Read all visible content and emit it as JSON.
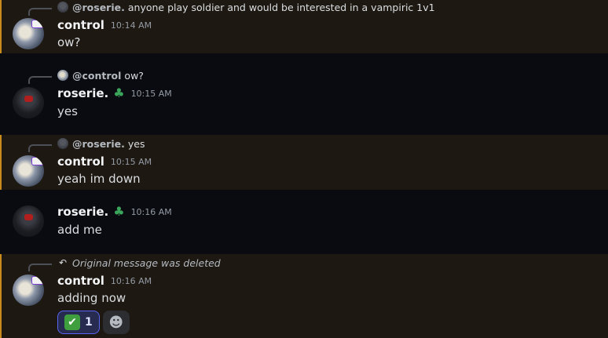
{
  "messages": [
    {
      "author": "control",
      "timestamp": "10:14 AM",
      "content": "ow?",
      "highlighted": true,
      "reply": {
        "user": "@roserie.",
        "text": "anyone play soldier and would be interested in a vampiric 1v1"
      }
    },
    {
      "author": "roserie.",
      "badge_icon": "clover-icon",
      "timestamp": "10:15 AM",
      "content": "yes",
      "highlighted": false,
      "reply": {
        "user": "@control",
        "text": "ow?"
      }
    },
    {
      "author": "control",
      "timestamp": "10:15 AM",
      "content": "yeah im down",
      "highlighted": true,
      "reply": {
        "user": "@roserie.",
        "text": "yes"
      }
    },
    {
      "author": "roserie.",
      "badge_icon": "clover-icon",
      "timestamp": "10:16 AM",
      "content": "add me",
      "highlighted": false
    },
    {
      "author": "control",
      "timestamp": "10:16 AM",
      "content": "adding now",
      "highlighted": true,
      "reply": {
        "deleted_text": "Original message was deleted"
      },
      "reactions": [
        {
          "emoji": "✔",
          "emoji_name": "white-check-mark-icon",
          "count": "1"
        }
      ]
    }
  ],
  "colors": {
    "mention_bg": "#1d1812",
    "mention_bar": "#c88a1c",
    "plain_bg": "#0a0b10",
    "reaction_border": "#5865f2"
  }
}
